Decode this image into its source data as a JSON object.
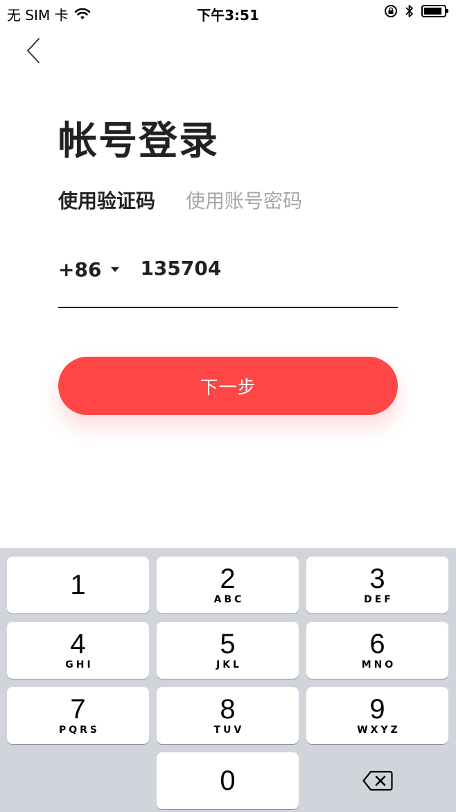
{
  "status_bar": {
    "carrier": "无 SIM 卡",
    "time": "下午3:51",
    "battery_level": 0.9
  },
  "header": {
    "title": "帐号登录"
  },
  "tabs": [
    {
      "label": "使用验证码",
      "active": true
    },
    {
      "label": "使用账号密码",
      "active": false
    }
  ],
  "phone": {
    "country_code": "+86",
    "value": "135704"
  },
  "next_button": {
    "label": "下一步",
    "color": "#ff4647"
  },
  "keypad": {
    "keys": [
      {
        "number": "1",
        "letters": ""
      },
      {
        "number": "2",
        "letters": "ABC"
      },
      {
        "number": "3",
        "letters": "DEF"
      },
      {
        "number": "4",
        "letters": "GHI"
      },
      {
        "number": "5",
        "letters": "JKL"
      },
      {
        "number": "6",
        "letters": "MNO"
      },
      {
        "number": "7",
        "letters": "PQRS"
      },
      {
        "number": "8",
        "letters": "TUV"
      },
      {
        "number": "9",
        "letters": "WXYZ"
      },
      {
        "number": "0",
        "letters": ""
      }
    ]
  }
}
